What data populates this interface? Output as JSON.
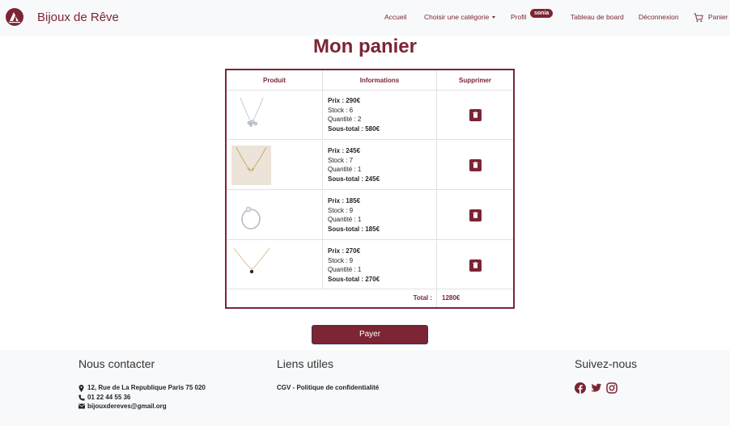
{
  "colors": {
    "accent": "#7b2535",
    "navbar_bg": "#f8f9fa"
  },
  "navbar": {
    "brand": "Bijoux de Rêve",
    "items": [
      {
        "label": "Accueil"
      },
      {
        "label": "Choisir une catégorie"
      },
      {
        "label": "Profil"
      },
      {
        "label": "Tableau de board"
      },
      {
        "label": "Déconnexion"
      },
      {
        "label": "Panier"
      }
    ],
    "profile_badge": "sonia"
  },
  "page": {
    "title": "Mon panier"
  },
  "table": {
    "headers": [
      "Produit",
      "Informations",
      "Supprimer"
    ],
    "rows": [
      {
        "image_icon": "necklace-icon",
        "prix": "Prix : 290€",
        "stock": "Stock : 6",
        "quantite": "Quantité : 2",
        "sous_total": "Sous-total : 580€"
      },
      {
        "image_icon": "necklace-icon",
        "prix": "Prix : 245€",
        "stock": "Stock : 7",
        "quantite": "Quantité : 1",
        "sous_total": "Sous-total : 245€"
      },
      {
        "image_icon": "ring-icon",
        "prix": "Prix : 185€",
        "stock": "Stock : 9",
        "quantite": "Quantité : 1",
        "sous_total": "Sous-total : 185€"
      },
      {
        "image_icon": "pendant-icon",
        "prix": "Prix : 270€",
        "stock": "Stock : 9",
        "quantite": "Quantité : 1",
        "sous_total": "Sous-total : 270€"
      }
    ],
    "total_label": "Total :",
    "total_value": "1280€"
  },
  "pay_button": "Payer",
  "footer": {
    "contact_title": "Nous contacter",
    "address": "12, Rue de La Republique Paris 75 020",
    "phone": "01 22 44 55 36",
    "email": "bijouxdereves@gmail.org",
    "links_title": "Liens utiles",
    "links": "CGV - Politique de confidentialité",
    "social_title": "Suivez-nous",
    "social_icons": [
      "facebook-icon",
      "twitter-icon",
      "instagram-icon"
    ]
  }
}
